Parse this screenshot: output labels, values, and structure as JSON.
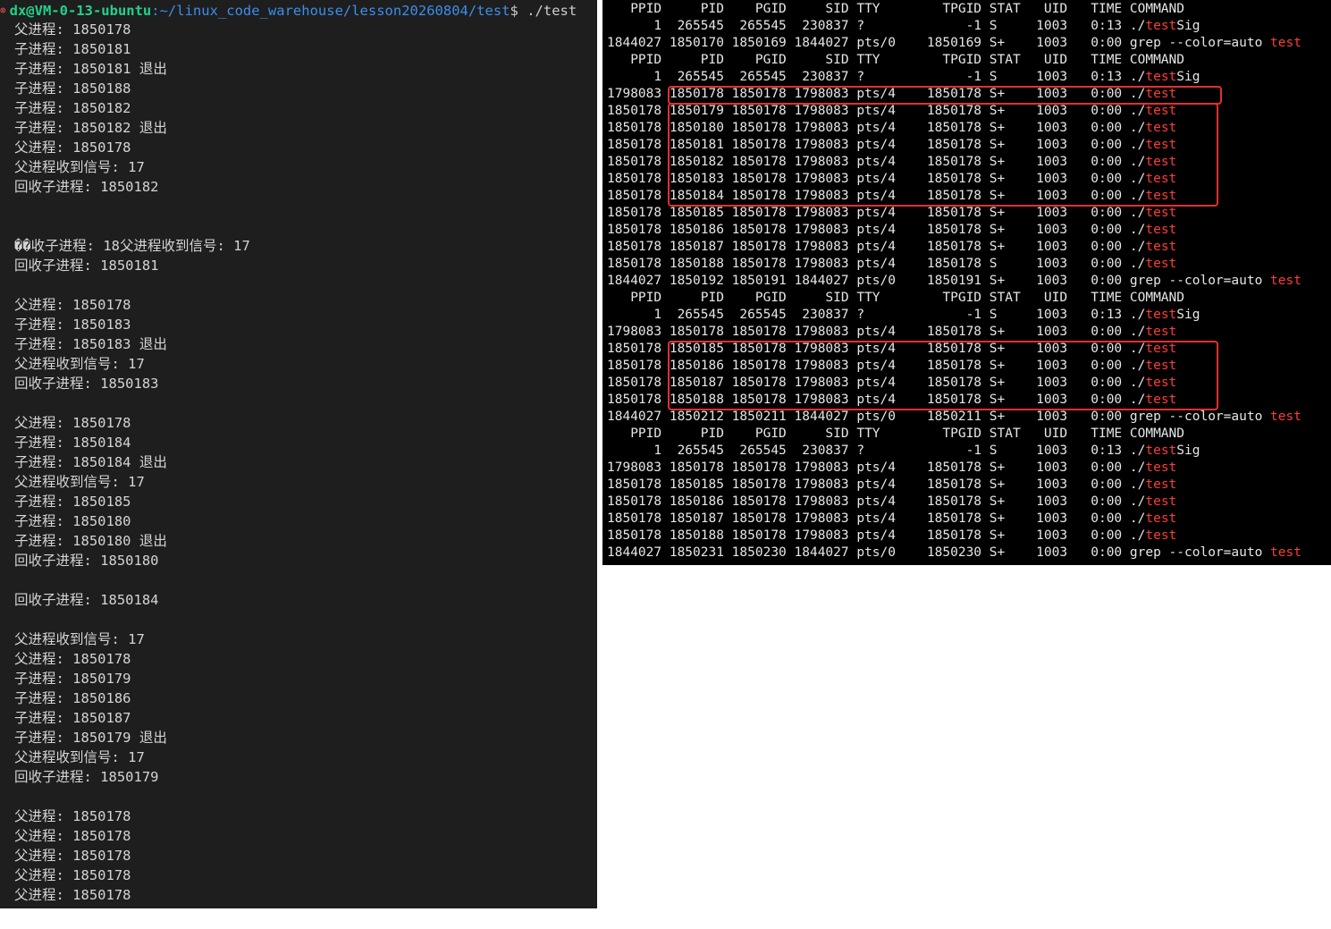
{
  "left_terminal": {
    "prompt": {
      "status_icon": "error-x-icon",
      "user_host": "dx@VM-0-13-ubuntu",
      "path": ":~/linux_code_warehouse/lesson20260804/test",
      "symbol": "$",
      "command": " ./test"
    },
    "lines": [
      "父进程: 1850178",
      "子进程: 1850181",
      "子进程: 1850181 退出",
      "子进程: 1850188",
      "子进程: 1850182",
      "子进程: 1850182 退出",
      "父进程: 1850178",
      "父进程收到信号: 17",
      "回收子进程: 1850182",
      "",
      "",
      "��收子进程: 18父进程收到信号: 17",
      "回收子进程: 1850181",
      "",
      "父进程: 1850178",
      "子进程: 1850183",
      "子进程: 1850183 退出",
      "父进程收到信号: 17",
      "回收子进程: 1850183",
      "",
      "父进程: 1850178",
      "子进程: 1850184",
      "子进程: 1850184 退出",
      "父进程收到信号: 17",
      "子进程: 1850185",
      "子进程: 1850180",
      "子进程: 1850180 退出",
      "回收子进程: 1850180",
      "",
      "回收子进程: 1850184",
      "",
      "父进程收到信号: 17",
      "父进程: 1850178",
      "子进程: 1850179",
      "子进程: 1850186",
      "子进程: 1850187",
      "子进程: 1850179 退出",
      "父进程收到信号: 17",
      "回收子进程: 1850179",
      "",
      "父进程: 1850178",
      "父进程: 1850178",
      "父进程: 1850178",
      "父进程: 1850178",
      "父进程: 1850178"
    ]
  },
  "right_terminal": {
    "highlight_color": "#ff3b3b",
    "box_color": "#e0312f",
    "lines": [
      {
        "pre": "   PPID     PID    PGID     SID TTY        TPGID STAT   UID   TIME COMMAND"
      },
      {
        "pre": "      1  265545  265545  230837 ?             -1 S     1003   0:13 ./",
        "hl": "test",
        "post": "Sig"
      },
      {
        "pre": "1844027 1850170 1850169 1844027 pts/0    1850169 S+    1003   0:00 grep --color=auto ",
        "hl": "test"
      },
      {
        "pre": "   PPID     PID    PGID     SID TTY        TPGID STAT   UID   TIME COMMAND"
      },
      {
        "pre": "      1  265545  265545  230837 ?             -1 S     1003   0:13 ./",
        "hl": "test",
        "post": "Sig"
      },
      {
        "pre": "1798083 1850178 1850178 1798083 pts/4    1850178 S+    1003   0:00 ./",
        "hl": "test"
      },
      {
        "pre": "1850178 1850179 1850178 1798083 pts/4    1850178 S+    1003   0:00 ./",
        "hl": "test"
      },
      {
        "pre": "1850178 1850180 1850178 1798083 pts/4    1850178 S+    1003   0:00 ./",
        "hl": "test"
      },
      {
        "pre": "1850178 1850181 1850178 1798083 pts/4    1850178 S+    1003   0:00 ./",
        "hl": "test"
      },
      {
        "pre": "1850178 1850182 1850178 1798083 pts/4    1850178 S+    1003   0:00 ./",
        "hl": "test"
      },
      {
        "pre": "1850178 1850183 1850178 1798083 pts/4    1850178 S+    1003   0:00 ./",
        "hl": "test"
      },
      {
        "pre": "1850178 1850184 1850178 1798083 pts/4    1850178 S+    1003   0:00 ./",
        "hl": "test"
      },
      {
        "pre": "1850178 1850185 1850178 1798083 pts/4    1850178 S+    1003   0:00 ./",
        "hl": "test"
      },
      {
        "pre": "1850178 1850186 1850178 1798083 pts/4    1850178 S+    1003   0:00 ./",
        "hl": "test"
      },
      {
        "pre": "1850178 1850187 1850178 1798083 pts/4    1850178 S+    1003   0:00 ./",
        "hl": "test"
      },
      {
        "pre": "1850178 1850188 1850178 1798083 pts/4    1850178 S     1003   0:00 ./",
        "hl": "test"
      },
      {
        "pre": "1844027 1850192 1850191 1844027 pts/0    1850191 S+    1003   0:00 grep --color=auto ",
        "hl": "test"
      },
      {
        "pre": "   PPID     PID    PGID     SID TTY        TPGID STAT   UID   TIME COMMAND"
      },
      {
        "pre": "      1  265545  265545  230837 ?             -1 S     1003   0:13 ./",
        "hl": "test",
        "post": "Sig"
      },
      {
        "pre": "1798083 1850178 1850178 1798083 pts/4    1850178 S+    1003   0:00 ./",
        "hl": "test"
      },
      {
        "pre": "1850178 1850185 1850178 1798083 pts/4    1850178 S+    1003   0:00 ./",
        "hl": "test"
      },
      {
        "pre": "1850178 1850186 1850178 1798083 pts/4    1850178 S+    1003   0:00 ./",
        "hl": "test"
      },
      {
        "pre": "1850178 1850187 1850178 1798083 pts/4    1850178 S+    1003   0:00 ./",
        "hl": "test"
      },
      {
        "pre": "1850178 1850188 1850178 1798083 pts/4    1850178 S+    1003   0:00 ./",
        "hl": "test"
      },
      {
        "pre": "1844027 1850212 1850211 1844027 pts/0    1850211 S+    1003   0:00 grep --color=auto ",
        "hl": "test"
      },
      {
        "pre": "   PPID     PID    PGID     SID TTY        TPGID STAT   UID   TIME COMMAND"
      },
      {
        "pre": "      1  265545  265545  230837 ?             -1 S     1003   0:13 ./",
        "hl": "test",
        "post": "Sig"
      },
      {
        "pre": "1798083 1850178 1850178 1798083 pts/4    1850178 S+    1003   0:00 ./",
        "hl": "test"
      },
      {
        "pre": "1850178 1850185 1850178 1798083 pts/4    1850178 S+    1003   0:00 ./",
        "hl": "test"
      },
      {
        "pre": "1850178 1850186 1850178 1798083 pts/4    1850178 S+    1003   0:00 ./",
        "hl": "test"
      },
      {
        "pre": "1850178 1850187 1850178 1798083 pts/4    1850178 S+    1003   0:00 ./",
        "hl": "test"
      },
      {
        "pre": "1850178 1850188 1850178 1798083 pts/4    1850178 S+    1003   0:00 ./",
        "hl": "test"
      },
      {
        "pre": "1844027 1850231 1850230 1844027 pts/0    1850230 S+    1003   0:00 grep --color=auto ",
        "hl": "test"
      }
    ]
  }
}
